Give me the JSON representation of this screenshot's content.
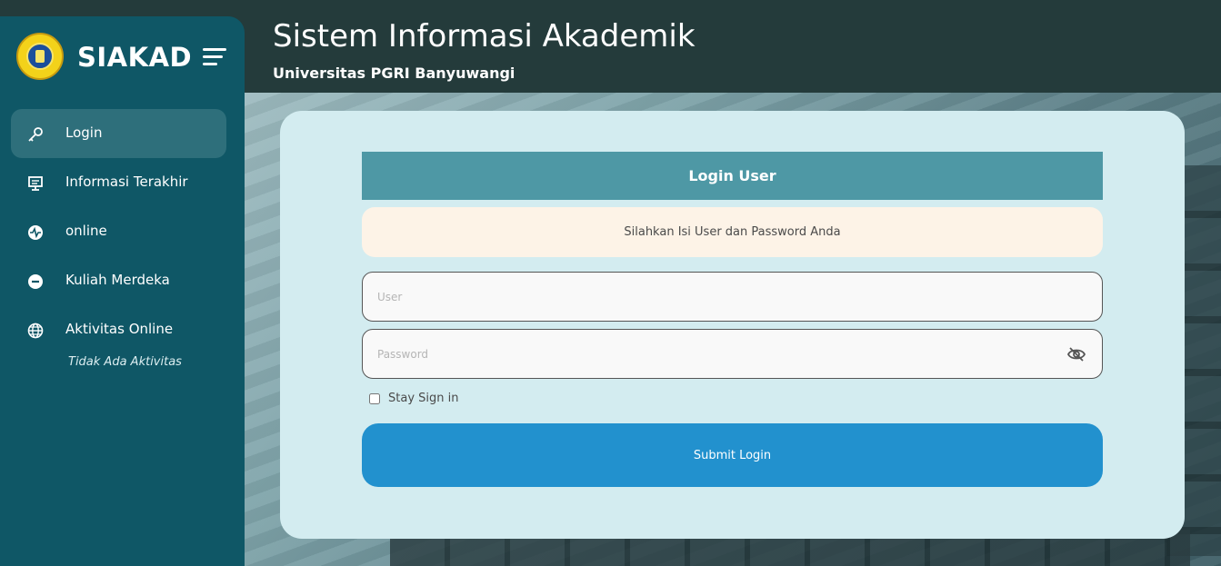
{
  "brand": {
    "title": "SIAKAD"
  },
  "header": {
    "title": "Sistem Informasi Akademik",
    "subtitle": "Universitas PGRI Banyuwangi"
  },
  "sidebar": {
    "items": [
      {
        "label": "Login",
        "icon": "key-icon",
        "active": true
      },
      {
        "label": "Informasi Terakhir",
        "icon": "monitor-icon",
        "active": false
      },
      {
        "label": "online",
        "icon": "activity-icon",
        "active": false
      },
      {
        "label": "Kuliah Merdeka",
        "icon": "minus-circle-icon",
        "active": false
      },
      {
        "label": "Aktivitas Online",
        "icon": "globe-icon",
        "active": false
      }
    ],
    "activity_note": "Tidak Ada Aktivitas"
  },
  "login": {
    "heading": "Login User",
    "alert": "Silahkan Isi User dan Password Anda",
    "user_placeholder": "User",
    "password_placeholder": "Password",
    "stay_label": "Stay Sign in",
    "submit_label": "Submit Login"
  },
  "colors": {
    "sidebar": "#0f5766",
    "header": "#243b3b",
    "card": "#d3ecf0",
    "card_head": "#4e98a5",
    "submit": "#2291ce"
  }
}
